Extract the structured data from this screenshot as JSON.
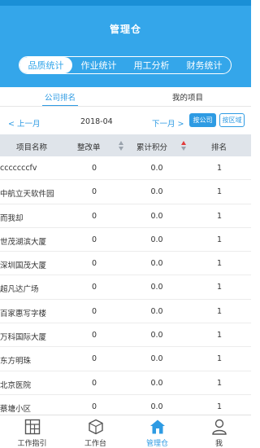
{
  "header": {
    "title": "管理仓",
    "segments": [
      {
        "label": "品质统计",
        "active": true
      },
      {
        "label": "作业统计",
        "active": false
      },
      {
        "label": "用工分析",
        "active": false
      },
      {
        "label": "财务统计",
        "active": false
      }
    ]
  },
  "subtabs": {
    "company_rank": "公司排名",
    "my_projects": "我的项目"
  },
  "monthbar": {
    "prev_label": "< 上一月",
    "month": "2018-04",
    "next_label": "下一月 >",
    "by_company": "按公司",
    "by_region": "按区域"
  },
  "table": {
    "headers": [
      "项目名称",
      "整改单",
      "累计积分",
      "排名"
    ],
    "rows": [
      [
        "cccccccfv",
        "0",
        "0.0",
        "1"
      ],
      [
        "中航立天软件园",
        "0",
        "0.0",
        "1"
      ],
      [
        "而我却",
        "0",
        "0.0",
        "1"
      ],
      [
        "世茂湖滨大厦",
        "0",
        "0.0",
        "1"
      ],
      [
        "深圳国茂大厦",
        "0",
        "0.0",
        "1"
      ],
      [
        "超凡达广场",
        "0",
        "0.0",
        "1"
      ],
      [
        "百家惠写字楼",
        "0",
        "0.0",
        "1"
      ],
      [
        "万科国际大厦",
        "0",
        "0.0",
        "1"
      ],
      [
        "东方明珠",
        "0",
        "0.0",
        "1"
      ],
      [
        "北京医院",
        "0",
        "0.0",
        "1"
      ],
      [
        "蔡塘小区",
        "0",
        "0.0",
        "1"
      ]
    ]
  },
  "tabbar": {
    "items": [
      {
        "label": "工作指引",
        "icon": "grid-icon",
        "active": false
      },
      {
        "label": "工作台",
        "icon": "cube-icon",
        "active": false
      },
      {
        "label": "管理仓",
        "icon": "home-icon",
        "active": true
      },
      {
        "label": "我",
        "icon": "person-icon",
        "active": false
      }
    ]
  },
  "colors": {
    "primary": "#34a6ea",
    "accent": "#2e9be3",
    "sort_active": "#e23b3b"
  }
}
